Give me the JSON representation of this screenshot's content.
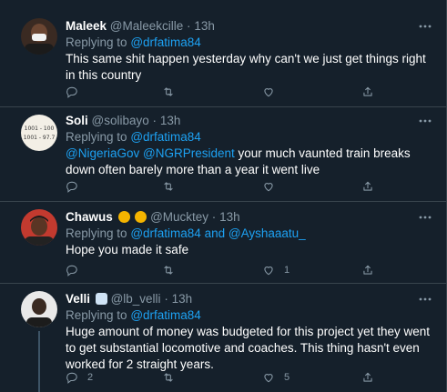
{
  "colors": {
    "background": "#15202b",
    "divider": "#38444d",
    "text_primary": "#ffffff",
    "text_secondary": "#8899a6",
    "link": "#1da1f2"
  },
  "tweets": [
    {
      "name": "Maleek",
      "handle": "@Maleekcille",
      "dot": "·",
      "time": "13h",
      "replying_prefix": "Replying to",
      "replying_to": [
        "@drfatima84"
      ],
      "mentions": [],
      "body": "This same shit happen yesterday why can't we just get things right in this country",
      "reply_count": "",
      "like_count": ""
    },
    {
      "name": "Soli",
      "handle": "@solibayo",
      "dot": "·",
      "time": "13h",
      "replying_prefix": "Replying to",
      "replying_to": [
        "@drfatima84"
      ],
      "mentions": [
        "@NigeriaGov",
        "@NGRPresident"
      ],
      "body": "your much vaunted train breaks down often barely more than a year it went live",
      "reply_count": "",
      "like_count": "",
      "avatar_text": [
        "1001 - 100",
        "1001 - 97.7"
      ]
    },
    {
      "name": "Chawus",
      "handle": "@Mucktey",
      "dot": "·",
      "time": "13h",
      "replying_prefix": "Replying to",
      "replying_to": [
        "@drfatima84",
        "@Ayshaaatu_"
      ],
      "replying_join": "and",
      "mentions": [],
      "body": "Hope you made it safe",
      "reply_count": "",
      "like_count": "1"
    },
    {
      "name": "Velli",
      "handle": "@lb_velli",
      "dot": "·",
      "time": "13h",
      "replying_prefix": "Replying to",
      "replying_to": [
        "@drfatima84"
      ],
      "mentions": [],
      "body": "Huge amount of money was budgeted for this project yet they went to get substantial locomotive and coaches. This thing hasn't even worked for 2 straight years.",
      "reply_count": "2",
      "like_count": "5"
    }
  ],
  "icons": {
    "more": "more-icon",
    "reply": "reply-icon",
    "retweet": "retweet-icon",
    "like": "like-icon",
    "share": "share-icon"
  }
}
